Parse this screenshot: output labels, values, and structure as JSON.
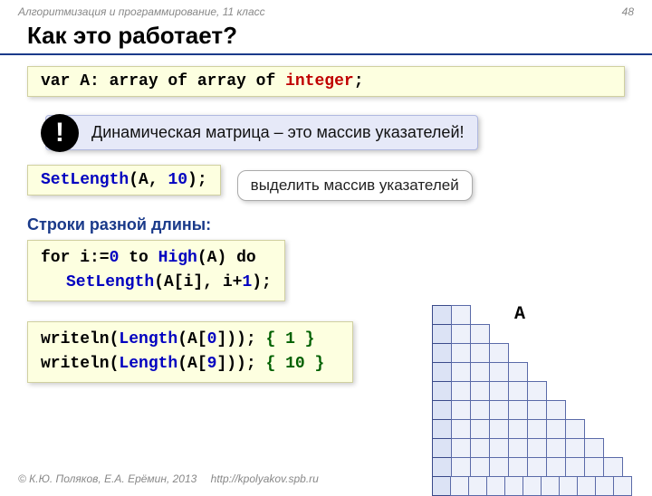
{
  "header": {
    "topic": "Алгоритмизация и программирование, 11 класс",
    "pagenum": "48"
  },
  "title": "Как это работает?",
  "code1": {
    "p1": "var",
    "p2": " A: ",
    "p3": "array of array of",
    "p4": " integer",
    "p5": ";"
  },
  "callout": {
    "mark": "!",
    "text": "Динамическая матрица – это  массив указателей!"
  },
  "code2": {
    "fn": "SetLength",
    "args": "(A, ",
    "n": "10",
    "close": ");"
  },
  "speech1": "выделить массив указателей",
  "subhead": "Строки разной длины:",
  "code3": {
    "l1a": "for",
    "l1b": " i:=",
    "l1c": "0",
    "l1d": " to ",
    "l1e": "High",
    "l1f": "(A) ",
    "l1g": "do",
    "l2a": "SetLength",
    "l2b": "(A[i], i+",
    "l2c": "1",
    "l2d": ");"
  },
  "code4": {
    "l1a": "writeln(",
    "l1b": "Length",
    "l1c": "(A[",
    "l1d": "0",
    "l1e": "])); ",
    "l1f": "{ 1 }",
    "l2a": "writeln(",
    "l2b": "Length",
    "l2c": "(A[",
    "l2d": "9",
    "l2e": "])); ",
    "l2f": "{ 10 }"
  },
  "triangle": {
    "label": "A",
    "rows": 10
  },
  "footer": {
    "copyright": "© К.Ю. Поляков, Е.А. Ерёмин, 2013",
    "url": "http://kpolyakov.spb.ru"
  }
}
